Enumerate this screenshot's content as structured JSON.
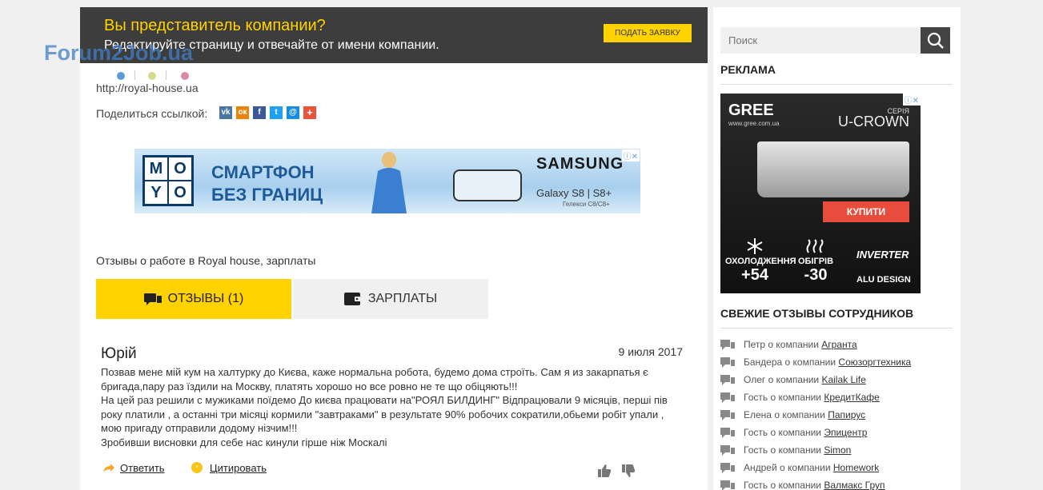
{
  "site": {
    "logo": "Forum2Job.ua"
  },
  "promo": {
    "title": "Вы представитель компании?",
    "subtitle": "Редактируйте страницу и отвечайте от имени компании.",
    "button": "ПОДАТЬ ЗАЯВКУ"
  },
  "company": {
    "url": "http://royal-house.ua",
    "share_label": "Поделиться ссылкой:",
    "share_icons": [
      "vk-icon",
      "odnoklassniki-icon",
      "facebook-icon",
      "twitter-icon",
      "mail-icon",
      "plus-icon"
    ]
  },
  "banner": {
    "brand": [
      "M",
      "O",
      "Y",
      "O"
    ],
    "headline_line1": "СМАРТФОН",
    "headline_line2": "БЕЗ ГРАНИЦ",
    "vendor": "SAMSUNG",
    "product": "Galaxy S8 | S8+",
    "product_note": "Гелекси С8/С8+",
    "ad_mark": "ⓘ✕"
  },
  "reviews_section": {
    "title": "Отзывы о работе в Royal house, зарплаты",
    "tabs": [
      {
        "label": "ОТЗЫВЫ (1)",
        "active": true
      },
      {
        "label": "ЗАРПЛАТЫ",
        "active": false
      }
    ]
  },
  "review": {
    "author": "Юрій",
    "date": "9 июля 2017",
    "paragraphs": [
      "Позвав мене мій кум на халтурку до Києва, каже нормальна робота, будемо дома строїть. Сам я из закарпатья є бригада,пару раз їздили на Москву, платять хорошо но все ровно не те що обіцяють!!!",
      "На цей раз решили с мужиками поїдемо До києва працювати на\"РОЯЛ БИЛДИНГ\" Відпрацювали 9 місяців, перші пів року платили , а останні три місяці кормили \"завтраками\" в результате 90% робочих сократили,обьеми робіт упали , мою пригаду отправили додому нізчим!!!",
      "Зробивши висновки для себе нас кинули гірше ніж Москалі"
    ],
    "reply_label": "Ответить",
    "quote_label": "Цитировать"
  },
  "sidebar": {
    "search_placeholder": "Поиск",
    "ads_title": "РЕКЛАМА",
    "gree_ad": {
      "brand": "GREE",
      "site": "www.gree.com.ua",
      "seria": "СЕРІЯ",
      "model": "U-CROWN",
      "buy": "КУПИТИ",
      "cool_label": "ОХОЛОДЖЕННЯ",
      "cool_value": "+54",
      "heat_label": "ОБІГРІВ",
      "heat_value": "-30",
      "inverter": "INVERTER",
      "alu": "ALU DESIGN",
      "ad_mark": "ⓘ✕"
    },
    "fresh_title": "СВЕЖИЕ ОТЗЫВЫ СОТРУДНИКОВ",
    "fresh_reviews": [
      {
        "prefix": "Петр о компании",
        "company": "Агранта"
      },
      {
        "prefix": "Бандера о компании",
        "company": "Союзоргтехника"
      },
      {
        "prefix": "Олег о компании",
        "company": "Kailak Life"
      },
      {
        "prefix": "Гость о компании",
        "company": "КредитКафе"
      },
      {
        "prefix": "Елена о компании",
        "company": "Папирус"
      },
      {
        "prefix": "Гость о компании",
        "company": "Эпицентр"
      },
      {
        "prefix": "Гость о компании",
        "company": "Simon"
      },
      {
        "prefix": "Андрей о компании",
        "company": "Homework"
      },
      {
        "prefix": "Гость о компании",
        "company": "Валмакс Груп"
      }
    ]
  },
  "colors": {
    "accent": "#ffd200",
    "promo_bg": "#3d3d3d",
    "logo": "#3f7fc8"
  }
}
